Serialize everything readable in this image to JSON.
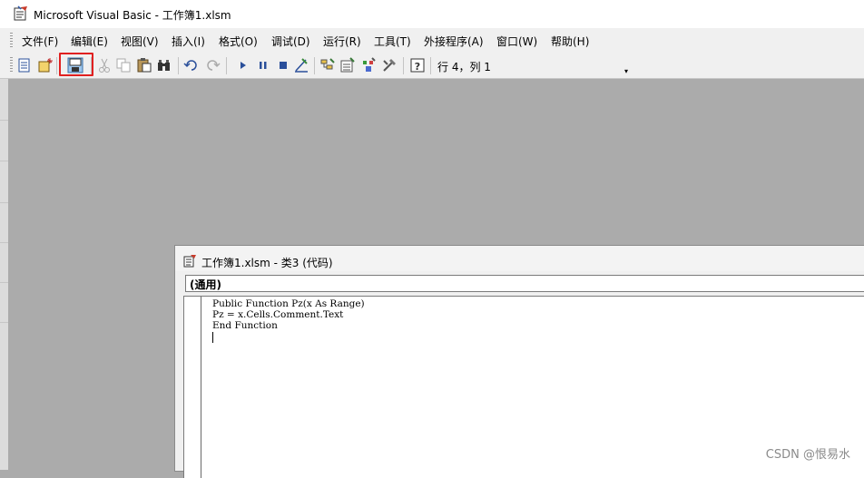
{
  "window": {
    "title": "Microsoft Visual Basic - 工作簿1.xlsm"
  },
  "menu": [
    "文件(F)",
    "编辑(E)",
    "视图(V)",
    "插入(I)",
    "格式(O)",
    "调试(D)",
    "运行(R)",
    "工具(T)",
    "外接程序(A)",
    "窗口(W)",
    "帮助(H)"
  ],
  "toolbar": {
    "buttons": [
      "view-excel-icon",
      "insert-module-icon",
      "save-icon",
      "cut-icon",
      "copy-icon",
      "paste-icon",
      "find-icon",
      "undo-icon",
      "redo-icon",
      "run-icon",
      "break-icon",
      "reset-icon",
      "design-mode-icon",
      "project-explorer-icon",
      "properties-icon",
      "object-browser-icon",
      "toolbox-icon",
      "help-icon"
    ],
    "cursor_position": "行 4，列 1",
    "overflow_arrow": "▾"
  },
  "code_window": {
    "title": "工作簿1.xlsm - 类3 (代码)",
    "object_combo": "(通用)",
    "lines": [
      "Public Function Pz(x As Range)",
      "Pz = x.Cells.Comment.Text",
      "End Function"
    ]
  },
  "watermark": "CSDN @恨易水",
  "colors": {
    "highlight": "#e02020",
    "workspace": "#ababab"
  }
}
